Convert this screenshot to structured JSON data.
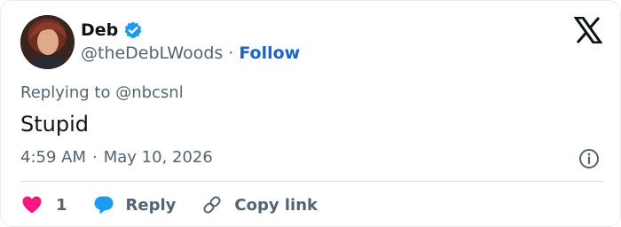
{
  "author": {
    "name": "Deb",
    "handle": "@theDebLWoods",
    "separator": "·",
    "follow_label": "Follow",
    "verified_color": "#1d9bf0"
  },
  "tweet": {
    "replying_to": "Replying to @nbcsnl",
    "text": "Stupid",
    "time": "4:59 AM",
    "date_separator": "·",
    "date": "May 10, 2026"
  },
  "actions": {
    "like_count": "1",
    "reply_label": "Reply",
    "copy_link_label": "Copy link"
  },
  "colors": {
    "like": "#f91880",
    "reply": "#1d9bf0",
    "link_blue": "#1d64c8",
    "muted": "#536471"
  },
  "icons": {
    "brand": "x-logo-icon",
    "info": "info-icon",
    "like": "heart-icon",
    "reply": "speech-bubble-icon",
    "copy_link": "link-icon",
    "verified": "verified-badge-icon"
  }
}
